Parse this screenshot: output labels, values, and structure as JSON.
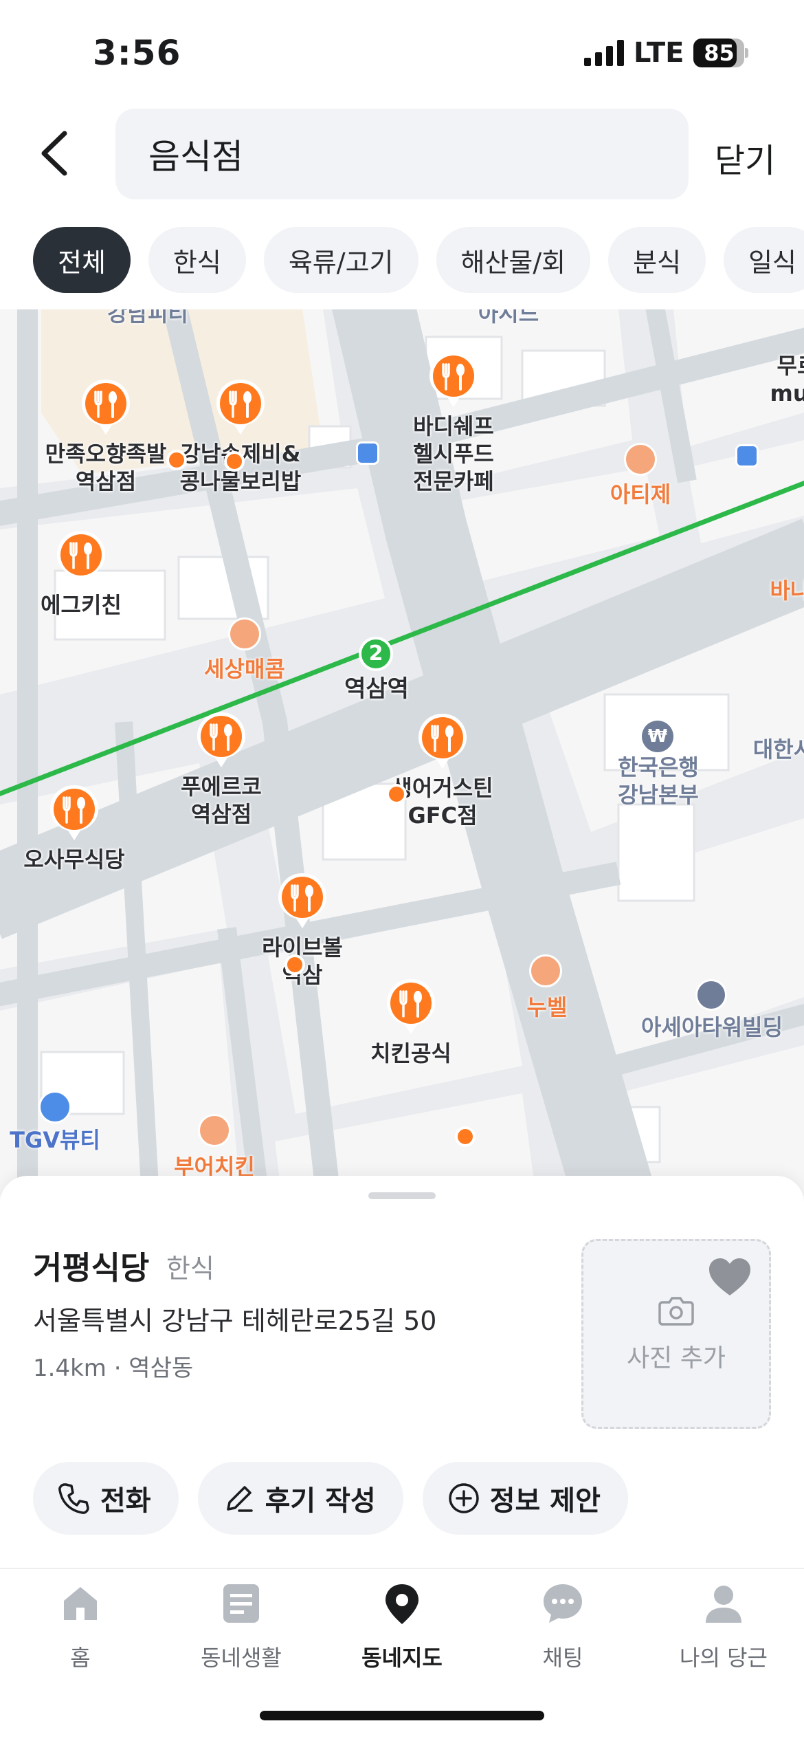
{
  "status_bar": {
    "time": "3:56",
    "network": "LTE",
    "battery_percent": 85
  },
  "header": {
    "search_value": "음식점",
    "close_label": "닫기"
  },
  "chips": [
    {
      "label": "전체",
      "active": true
    },
    {
      "label": "한식",
      "active": false
    },
    {
      "label": "육류/고기",
      "active": false
    },
    {
      "label": "해산물/회",
      "active": false
    },
    {
      "label": "분식",
      "active": false
    },
    {
      "label": "일식",
      "active": false
    }
  ],
  "map": {
    "subway_line_number": "2",
    "station_name": "역삼역",
    "restaurants": [
      "만족오향족발\n역삼점",
      "강남손제비&\n콩나물보리밥",
      "바디쉐프\n헬시푸드\n전문카페",
      "에그키친",
      "푸에르코\n역삼점",
      "생어거스틴\nGFC점",
      "오사무식당",
      "라이브볼\n역삼",
      "치킨공식"
    ],
    "small_places": [
      "세상매콤",
      "누벨",
      "부어치킨",
      "아티제",
      "바나"
    ],
    "pois": [
      "한국은행\n강남본부",
      "아세아타워빌딩",
      "TGV뷰티",
      "대한시"
    ],
    "edge_labels": [
      "강남피티",
      "아시드",
      "무르\nmuu"
    ],
    "colors": {
      "accent": "#ff7a1e",
      "subway_line": "#2db84a",
      "road": "#d3d8de",
      "block": "#f7f7f8"
    }
  },
  "place": {
    "name": "거평식당",
    "category": "한식",
    "address": "서울특별시 강남구 테헤란로25길 50",
    "meta": "1.4km · 역삼동",
    "photo_label": "사진 추가"
  },
  "actions": {
    "call": "전화",
    "review": "후기 작성",
    "suggest": "정보 제안"
  },
  "tabs": [
    {
      "label": "홈",
      "icon": "home-icon",
      "active": false
    },
    {
      "label": "동네생활",
      "icon": "community-icon",
      "active": false
    },
    {
      "label": "동네지도",
      "icon": "map-pin-icon",
      "active": true
    },
    {
      "label": "채팅",
      "icon": "chat-icon",
      "active": false
    },
    {
      "label": "나의 당근",
      "icon": "profile-icon",
      "active": false
    }
  ]
}
